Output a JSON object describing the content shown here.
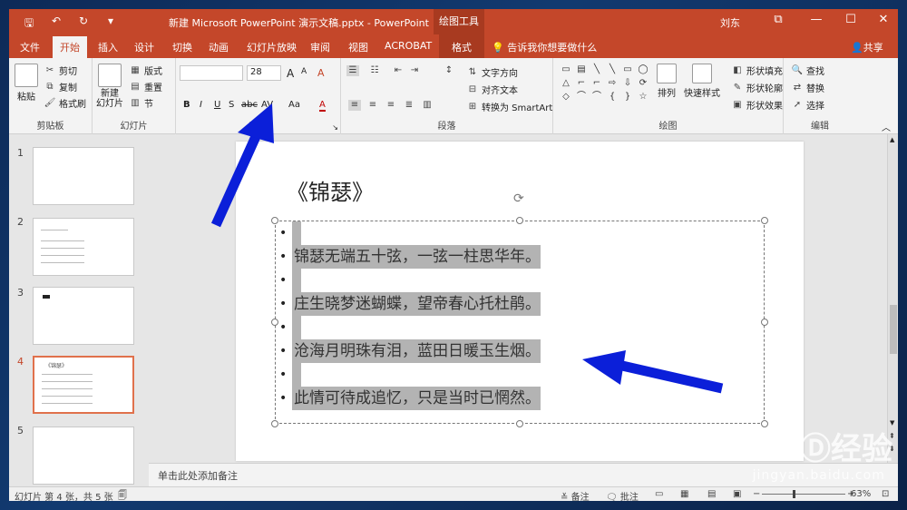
{
  "titlebar": {
    "doc_title": "新建 Microsoft PowerPoint 演示文稿.pptx  -  PowerPoint",
    "tools_tab": "绘图工具",
    "user": "刘东",
    "qat": {
      "save": "🖫",
      "undo": "↶",
      "redo": "↻",
      "customize": "▾"
    },
    "controls": {
      "ribbon_options": "⧉",
      "minimize": "—",
      "maximize": "☐",
      "close": "✕"
    }
  },
  "tabs": [
    {
      "label": "文件"
    },
    {
      "label": "开始"
    },
    {
      "label": "插入"
    },
    {
      "label": "设计"
    },
    {
      "label": "切换"
    },
    {
      "label": "动画"
    },
    {
      "label": "幻灯片放映"
    },
    {
      "label": "审阅"
    },
    {
      "label": "视图"
    },
    {
      "label": "ACROBAT"
    },
    {
      "label": "格式"
    }
  ],
  "tellme": "告诉我你想要做什么",
  "share": "共享",
  "ribbon": {
    "clipboard": {
      "paste": "粘贴",
      "cut": "剪切",
      "copy": "复制",
      "format_painter": "格式刷",
      "label": "剪贴板"
    },
    "slides": {
      "new_slide": "新建\n幻灯片",
      "layout": "版式",
      "reset": "重置",
      "section": "节",
      "label": "幻灯片"
    },
    "font": {
      "font_name": "",
      "font_size": "28",
      "grow": "A",
      "shrink": "A",
      "clear": "A",
      "bold": "B",
      "italic": "I",
      "underline": "U",
      "shadow": "S",
      "strike": "abc",
      "spacing": "AV",
      "case": "Aa",
      "color": "A",
      "label": "字体"
    },
    "paragraph": {
      "text_direction": "文字方向",
      "align_text": "对齐文本",
      "smartart": "转换为 SmartArt",
      "label": "段落"
    },
    "drawing": {
      "arrange": "排列",
      "quick_styles": "快速样式",
      "shape_fill": "形状填充",
      "shape_outline": "形状轮廓",
      "shape_effects": "形状效果",
      "label": "绘图",
      "shapes": [
        "▭",
        "▤",
        "╲",
        "╲",
        "▭",
        "◯",
        "△",
        "⌐",
        "⌐",
        "⇨",
        "⇩",
        "⟳",
        "◇",
        "⌒",
        "⌒",
        "{",
        "}",
        "☆"
      ]
    },
    "editing": {
      "find": "查找",
      "replace": "替换",
      "select": "选择",
      "label": "编辑"
    }
  },
  "thumbnails": [
    {
      "num": "1"
    },
    {
      "num": "2"
    },
    {
      "num": "3"
    },
    {
      "num": "4"
    },
    {
      "num": "5"
    }
  ],
  "slide": {
    "title": "《锦瑟》",
    "lines": [
      "锦瑟无端五十弦，一弦一柱思华年。",
      "庄生晓梦迷蝴蝶，望帝春心托杜鹃。",
      "沧海月明珠有泪，蓝田日暖玉生烟。",
      "此情可待成追忆，只是当时已惘然。"
    ],
    "bullet": "•"
  },
  "thumb4": {
    "title": "《锦瑟》"
  },
  "notes_placeholder": "单击此处添加备注",
  "status": {
    "slide_info": "幻灯片 第 4 张，共 5 张",
    "notes": "备注",
    "comments": "批注",
    "zoom": "63%",
    "zoom_minus": "−",
    "zoom_plus": "+"
  },
  "watermark": {
    "logo": "BaiⒹ经验",
    "url": "jingyan.baidu.com"
  },
  "colors": {
    "accent": "#c4472a",
    "arrow": "#0b1fd9"
  }
}
